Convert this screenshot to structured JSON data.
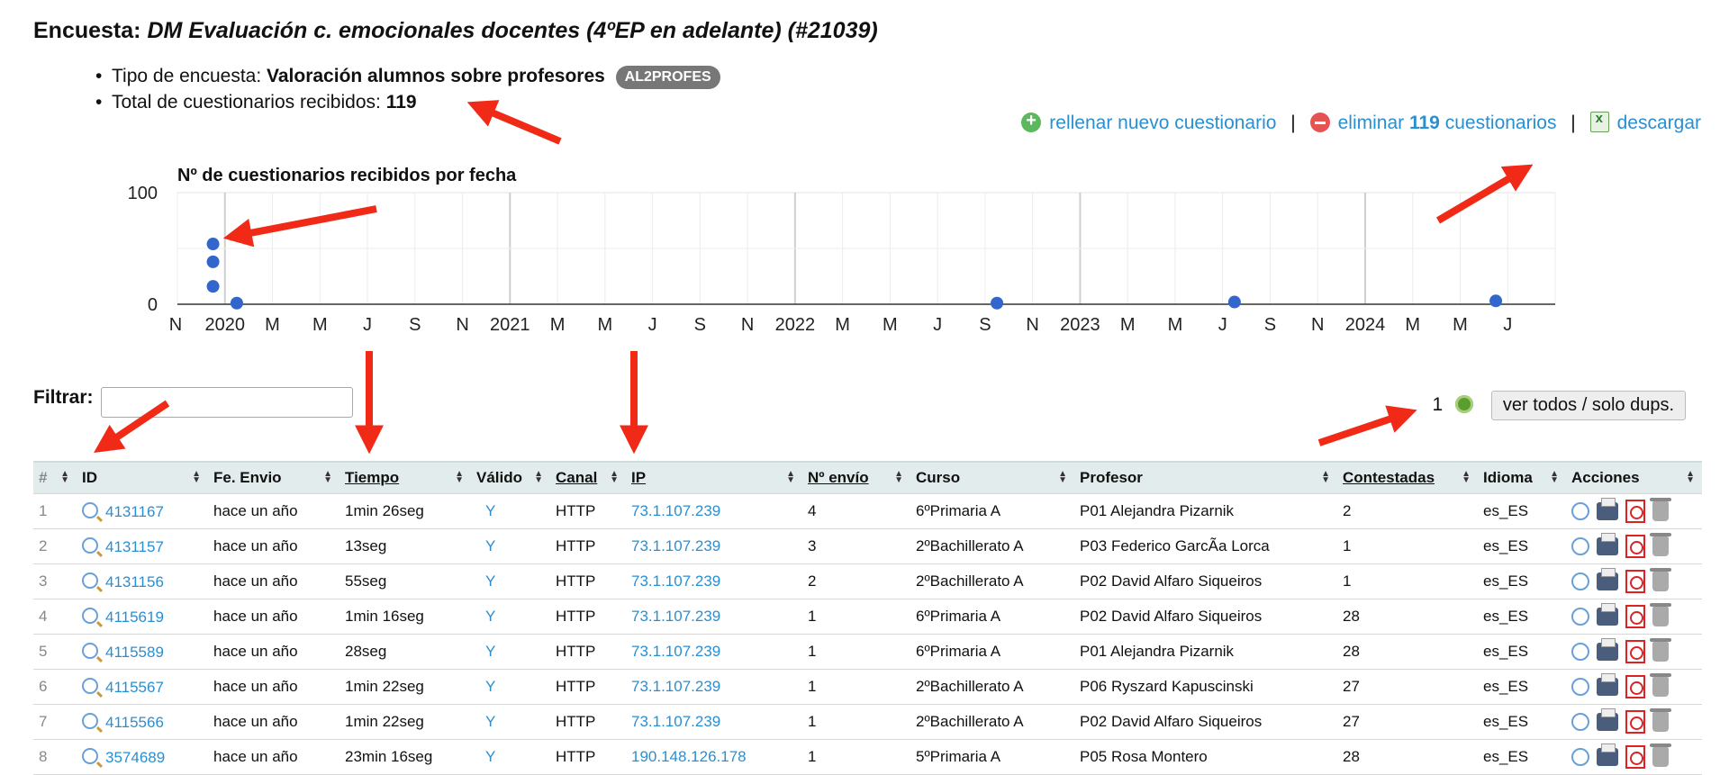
{
  "header": {
    "title_prefix": "Encuesta:",
    "title_name": "DM Evaluación c. emocionales docentes (4ºEP en adelante) (#21039)",
    "type_label": "Tipo de encuesta:",
    "type_value": "Valoración alumnos sobre profesores",
    "type_badge": "AL2PROFES",
    "total_label": "Total de cuestionarios recibidos:",
    "total_value": "119"
  },
  "actions": {
    "new_label": "rellenar nuevo cuestionario",
    "delete_prefix": "eliminar",
    "delete_count": "119",
    "delete_suffix": "cuestionarios",
    "download_label": "descargar",
    "divider": "|"
  },
  "chart_data": {
    "type": "scatter",
    "title": "Nº de cuestionarios recibidos por fecha",
    "ylim": [
      0,
      100
    ],
    "y_ticks": [
      "100",
      "0"
    ],
    "x_tick_labels": [
      "N",
      "2020",
      "M",
      "M",
      "J",
      "S",
      "N",
      "2021",
      "M",
      "M",
      "J",
      "S",
      "N",
      "2022",
      "M",
      "M",
      "J",
      "S",
      "N",
      "2023",
      "M",
      "M",
      "J",
      "S",
      "N",
      "2024",
      "M",
      "M",
      "J"
    ],
    "points": [
      {
        "x": "2019-12",
        "y": 54
      },
      {
        "x": "2019-12",
        "y": 38
      },
      {
        "x": "2019-12",
        "y": 16
      },
      {
        "x": "2020-01",
        "y": 1
      },
      {
        "x": "2022-09",
        "y": 1
      },
      {
        "x": "2023-07",
        "y": 2
      },
      {
        "x": "2024-06",
        "y": 3
      }
    ],
    "grid": true,
    "point_color": "#3366cc"
  },
  "filter": {
    "label": "Filtrar:",
    "value": "",
    "dup_count": "1",
    "toggle_label": "ver todos / solo dups."
  },
  "table": {
    "columns": [
      "#",
      "ID",
      "Fe. Envio",
      "Tiempo",
      "Válido",
      "Canal",
      "IP",
      "Nº envío",
      "Curso",
      "Profesor",
      "Contestadas",
      "Idioma",
      "Acciones"
    ],
    "rows": [
      {
        "n": "1",
        "id": "4131167",
        "fecha": "hace un año",
        "tiempo": "1min 26seg",
        "valido": "Y",
        "canal": "HTTP",
        "ip": "73.1.107.239",
        "envio": "4",
        "curso": "6ºPrimaria A",
        "profesor": "P01 Alejandra Pizarnik",
        "contestadas": "2",
        "idioma": "es_ES"
      },
      {
        "n": "2",
        "id": "4131157",
        "fecha": "hace un año",
        "tiempo": "13seg",
        "valido": "Y",
        "canal": "HTTP",
        "ip": "73.1.107.239",
        "envio": "3",
        "curso": "2ºBachillerato A",
        "profesor": "P03 Federico GarcÃa Lorca",
        "contestadas": "1",
        "idioma": "es_ES"
      },
      {
        "n": "3",
        "id": "4131156",
        "fecha": "hace un año",
        "tiempo": "55seg",
        "valido": "Y",
        "canal": "HTTP",
        "ip": "73.1.107.239",
        "envio": "2",
        "curso": "2ºBachillerato A",
        "profesor": "P02 David Alfaro Siqueiros",
        "contestadas": "1",
        "idioma": "es_ES"
      },
      {
        "n": "4",
        "id": "4115619",
        "fecha": "hace un año",
        "tiempo": "1min 16seg",
        "valido": "Y",
        "canal": "HTTP",
        "ip": "73.1.107.239",
        "envio": "1",
        "curso": "6ºPrimaria A",
        "profesor": "P02 David Alfaro Siqueiros",
        "contestadas": "28",
        "idioma": "es_ES"
      },
      {
        "n": "5",
        "id": "4115589",
        "fecha": "hace un año",
        "tiempo": "28seg",
        "valido": "Y",
        "canal": "HTTP",
        "ip": "73.1.107.239",
        "envio": "1",
        "curso": "6ºPrimaria A",
        "profesor": "P01 Alejandra Pizarnik",
        "contestadas": "28",
        "idioma": "es_ES"
      },
      {
        "n": "6",
        "id": "4115567",
        "fecha": "hace un año",
        "tiempo": "1min 22seg",
        "valido": "Y",
        "canal": "HTTP",
        "ip": "73.1.107.239",
        "envio": "1",
        "curso": "2ºBachillerato A",
        "profesor": "P06 Ryszard Kapuscinski",
        "contestadas": "27",
        "idioma": "es_ES"
      },
      {
        "n": "7",
        "id": "4115566",
        "fecha": "hace un año",
        "tiempo": "1min 22seg",
        "valido": "Y",
        "canal": "HTTP",
        "ip": "73.1.107.239",
        "envio": "1",
        "curso": "2ºBachillerato A",
        "profesor": "P02 David Alfaro Siqueiros",
        "contestadas": "27",
        "idioma": "es_ES"
      },
      {
        "n": "8",
        "id": "3574689",
        "fecha": "hace un año",
        "tiempo": "23min 16seg",
        "valido": "Y",
        "canal": "HTTP",
        "ip": "190.148.126.178",
        "envio": "1",
        "curso": "5ºPrimaria A",
        "profesor": "P05 Rosa Montero",
        "contestadas": "28",
        "idioma": "es_ES"
      }
    ]
  },
  "colors": {
    "link": "#2a8fd1",
    "annotation_arrow": "#f02a17",
    "table_header_bg": "#e3ecec"
  }
}
